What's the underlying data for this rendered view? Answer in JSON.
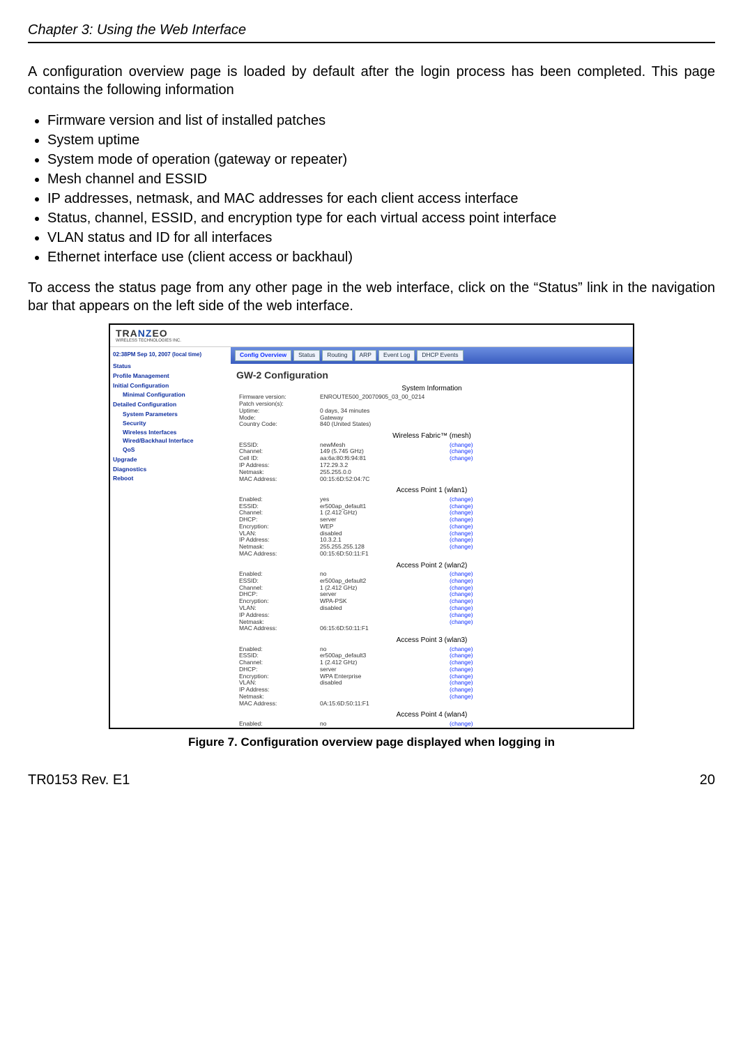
{
  "header": "Chapter 3: Using the Web Interface",
  "intro": "A configuration overview page is loaded by default after the login process has been completed. This page contains the following information",
  "bullets": [
    "Firmware version and list of installed patches",
    "System uptime",
    "System mode of operation (gateway or repeater)",
    "Mesh channel and ESSID",
    "IP addresses, netmask, and MAC addresses for each client access interface",
    "Status, channel, ESSID, and encryption type for each virtual access point interface",
    "VLAN status and ID for all interfaces",
    "Ethernet interface use (client access or backhaul)"
  ],
  "para2": "To access the status page from any other page in the web interface, click on the “Status” link in the navigation bar that appears on the left side of the web interface.",
  "caption": "Figure 7. Configuration overview page displayed when logging in",
  "footer_left": "TR0153 Rev. E1",
  "footer_right": "20",
  "shot": {
    "logo": {
      "pre": "TRA",
      "mid": "NZ",
      "post": "EO",
      "sub": "WIRELESS TECHNOLOGIES INC."
    },
    "time": "02:38PM Sep 10, 2007 (local time)",
    "sidebar": {
      "items": [
        {
          "t": "link",
          "label": "Status"
        },
        {
          "t": "link",
          "label": "Profile Management"
        },
        {
          "t": "head",
          "label": "Initial Configuration"
        },
        {
          "t": "sub",
          "label": "Minimal Configuration"
        },
        {
          "t": "head",
          "label": "Detailed Configuration"
        },
        {
          "t": "sub",
          "label": "System Parameters"
        },
        {
          "t": "sub",
          "label": "Security"
        },
        {
          "t": "sub",
          "label": "Wireless Interfaces"
        },
        {
          "t": "sub",
          "label": "Wired/Backhaul Interface"
        },
        {
          "t": "sub",
          "label": "QoS"
        },
        {
          "t": "link",
          "label": "Upgrade"
        },
        {
          "t": "link",
          "label": "Diagnostics"
        },
        {
          "t": "link",
          "label": "Reboot"
        }
      ]
    },
    "tabs": [
      "Config Overview",
      "Status",
      "Routing",
      "ARP",
      "Event Log",
      "DHCP Events"
    ],
    "title": "GW-2 Configuration",
    "change": "(change)",
    "sections": [
      {
        "heading": "System Information",
        "rows": [
          {
            "k": "Firmware version:",
            "v": "ENROUTE500_20070905_03_00_0214",
            "c": false
          },
          {
            "k": "Patch version(s):",
            "v": "",
            "c": false
          },
          {
            "k": "Uptime:",
            "v": "0 days, 34 minutes",
            "c": false
          },
          {
            "k": "Mode:",
            "v": "Gateway",
            "c": false
          },
          {
            "k": "Country Code:",
            "v": "840 (United States)",
            "c": false
          }
        ]
      },
      {
        "heading": "Wireless Fabric™ (mesh)",
        "rows": [
          {
            "k": "ESSID:",
            "v": "newMesh",
            "c": true
          },
          {
            "k": "Channel:",
            "v": "149 (5.745 GHz)",
            "c": true
          },
          {
            "k": "Cell ID:",
            "v": "aa:6a:80:f6:94:81",
            "c": true
          },
          {
            "k": "IP Address:",
            "v": "172.29.3.2",
            "c": false
          },
          {
            "k": "Netmask:",
            "v": "255.255.0.0",
            "c": false
          },
          {
            "k": "MAC Address:",
            "v": "00:15:6D:52:04:7C",
            "c": false
          }
        ]
      },
      {
        "heading": "Access Point 1 (wlan1)",
        "rows": [
          {
            "k": "Enabled:",
            "v": "yes",
            "c": true
          },
          {
            "k": "ESSID:",
            "v": "er500ap_default1",
            "c": true
          },
          {
            "k": "Channel:",
            "v": "1 (2.412 GHz)",
            "c": true
          },
          {
            "k": "DHCP:",
            "v": "server",
            "c": true
          },
          {
            "k": "Encryption:",
            "v": "WEP",
            "c": true
          },
          {
            "k": "VLAN:",
            "v": "disabled",
            "c": true
          },
          {
            "k": "IP Address:",
            "v": "10.3.2.1",
            "c": true
          },
          {
            "k": "Netmask:",
            "v": "255.255.255.128",
            "c": true
          },
          {
            "k": "MAC Address:",
            "v": "00:15:6D:50:11:F1",
            "c": false
          }
        ]
      },
      {
        "heading": "Access Point 2 (wlan2)",
        "rows": [
          {
            "k": "Enabled:",
            "v": "no",
            "c": true
          },
          {
            "k": "ESSID:",
            "v": "er500ap_default2",
            "c": true
          },
          {
            "k": "Channel:",
            "v": "1 (2.412 GHz)",
            "c": true
          },
          {
            "k": "DHCP:",
            "v": "server",
            "c": true
          },
          {
            "k": "Encryption:",
            "v": "WPA-PSK",
            "c": true
          },
          {
            "k": "VLAN:",
            "v": "disabled",
            "c": true
          },
          {
            "k": "IP Address:",
            "v": "",
            "c": true
          },
          {
            "k": "Netmask:",
            "v": "",
            "c": true
          },
          {
            "k": "MAC Address:",
            "v": "06:15:6D:50:11:F1",
            "c": false
          }
        ]
      },
      {
        "heading": "Access Point 3 (wlan3)",
        "rows": [
          {
            "k": "Enabled:",
            "v": "no",
            "c": true
          },
          {
            "k": "ESSID:",
            "v": "er500ap_default3",
            "c": true
          },
          {
            "k": "Channel:",
            "v": "1 (2.412 GHz)",
            "c": true
          },
          {
            "k": "DHCP:",
            "v": "server",
            "c": true
          },
          {
            "k": "Encryption:",
            "v": "WPA Enterprise",
            "c": true
          },
          {
            "k": "VLAN:",
            "v": "disabled",
            "c": true
          },
          {
            "k": "IP Address:",
            "v": "",
            "c": true
          },
          {
            "k": "Netmask:",
            "v": "",
            "c": true
          },
          {
            "k": "MAC Address:",
            "v": "0A:15:6D:50:11:F1",
            "c": false
          }
        ]
      },
      {
        "heading": "Access Point 4 (wlan4)",
        "rows": [
          {
            "k": "Enabled:",
            "v": "no",
            "c": true
          }
        ]
      }
    ]
  }
}
